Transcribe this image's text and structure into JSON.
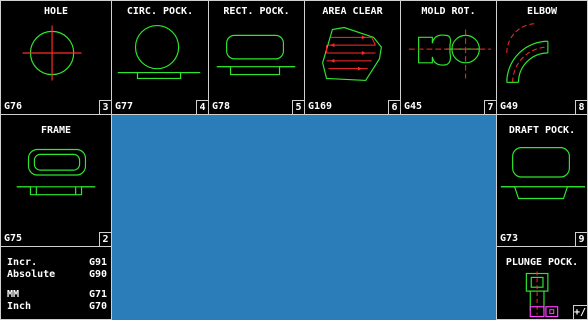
{
  "tiles": {
    "hole": {
      "title": "HOLE",
      "code": "G76",
      "num": "3"
    },
    "circ_pock": {
      "title": "CIRC. POCK.",
      "code": "G77",
      "num": "4"
    },
    "rect_pock": {
      "title": "RECT. POCK.",
      "code": "G78",
      "num": "5"
    },
    "area_clear": {
      "title": "AREA CLEAR",
      "code": "G169",
      "num": "6"
    },
    "mold_rot": {
      "title": "MOLD ROT.",
      "code": "G45",
      "num": "7"
    },
    "elbow": {
      "title": "ELBOW",
      "code": "G49",
      "num": "8"
    },
    "frame": {
      "title": "FRAME",
      "code": "G75",
      "num": "2"
    },
    "draft_pock": {
      "title": "DRAFT POCK.",
      "code": "G73",
      "num": "9"
    },
    "plunge_pock": {
      "title": "PLUNGE POCK.",
      "num": "+/-"
    }
  },
  "modes": {
    "incr": {
      "label": "Incr.",
      "code": "G91"
    },
    "absolute": {
      "label": "Absolute",
      "code": "G90"
    },
    "mm": {
      "label": "MM",
      "code": "G71"
    },
    "inch": {
      "label": "Inch",
      "code": "G70"
    }
  },
  "colors": {
    "graphic": "#2ee62e",
    "axis": "#ff2a2a",
    "accent": "#ff40ff",
    "canvas": "#2b7dba"
  }
}
